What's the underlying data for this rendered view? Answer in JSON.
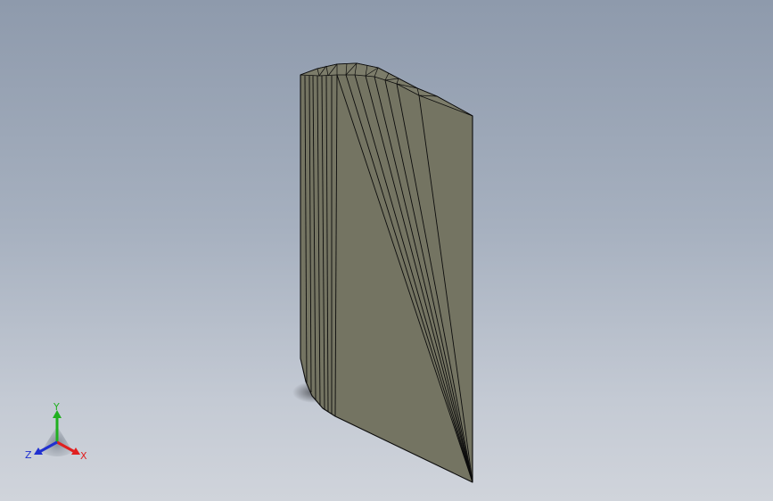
{
  "viewport": {
    "background_top": "#8e9aac",
    "background_bottom": "#d0d4db"
  },
  "model": {
    "face_color": "#747462",
    "edge_color": "#0c0c0c"
  },
  "triad": {
    "x_label": "X",
    "y_label": "Y",
    "z_label": "Z",
    "x_color": "#e02020",
    "y_color": "#20b020",
    "z_color": "#2030d0"
  }
}
